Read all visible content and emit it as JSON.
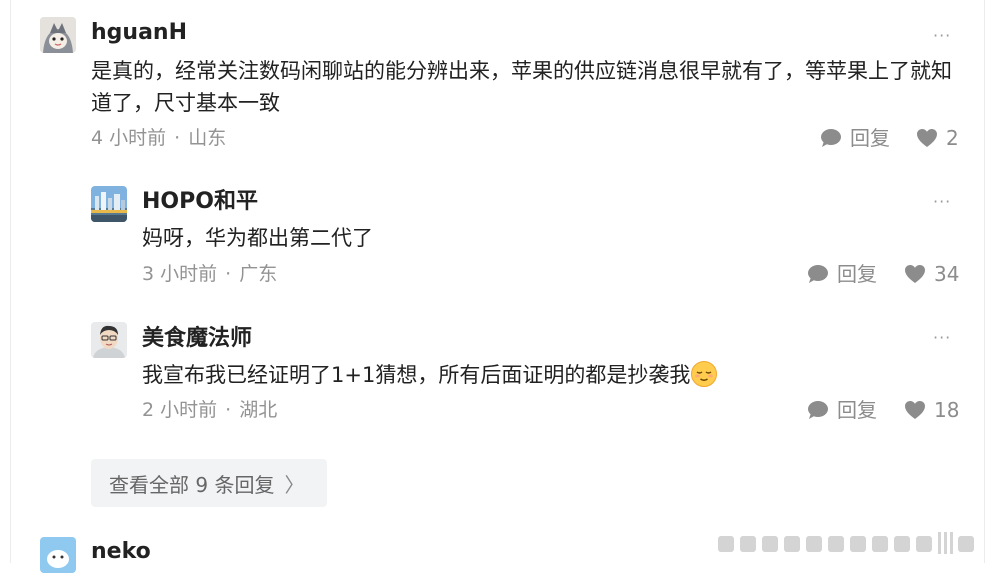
{
  "comments": [
    {
      "user": "hguanH",
      "text": "是真的，经常关注数码闲聊站的能分辨出来，苹果的供应链消息很早就有了，等苹果上了就知道了，尺寸基本一致",
      "time": "4 小时前",
      "location": "山东",
      "reply_label": "回复",
      "likes": "2"
    }
  ],
  "replies": [
    {
      "user": "HOPO和平",
      "text": "妈呀，华为都出第二代了",
      "time": "3 小时前",
      "location": "广东",
      "reply_label": "回复",
      "likes": "34"
    },
    {
      "user": "美食魔法师",
      "text": "我宣布我已经证明了1+1猜想，所有后面证明的都是抄袭我",
      "emoji": "relieved-face-emoji",
      "time": "2 小时前",
      "location": "湖北",
      "reply_label": "回复",
      "likes": "18"
    }
  ],
  "view_all": {
    "label": "查看全部 9 条回复",
    "chevron": "〉"
  },
  "next_comment": {
    "user": "neko"
  },
  "meta_separator": "·",
  "more_glyph": "···",
  "icons": {
    "reply": "speech-bubble-icon",
    "like": "heart-icon",
    "more": "ellipsis-icon"
  },
  "colors": {
    "text": "#222222",
    "meta": "#939393",
    "icon": "#8c8c8c",
    "view_all_bg": "#f2f3f5"
  }
}
